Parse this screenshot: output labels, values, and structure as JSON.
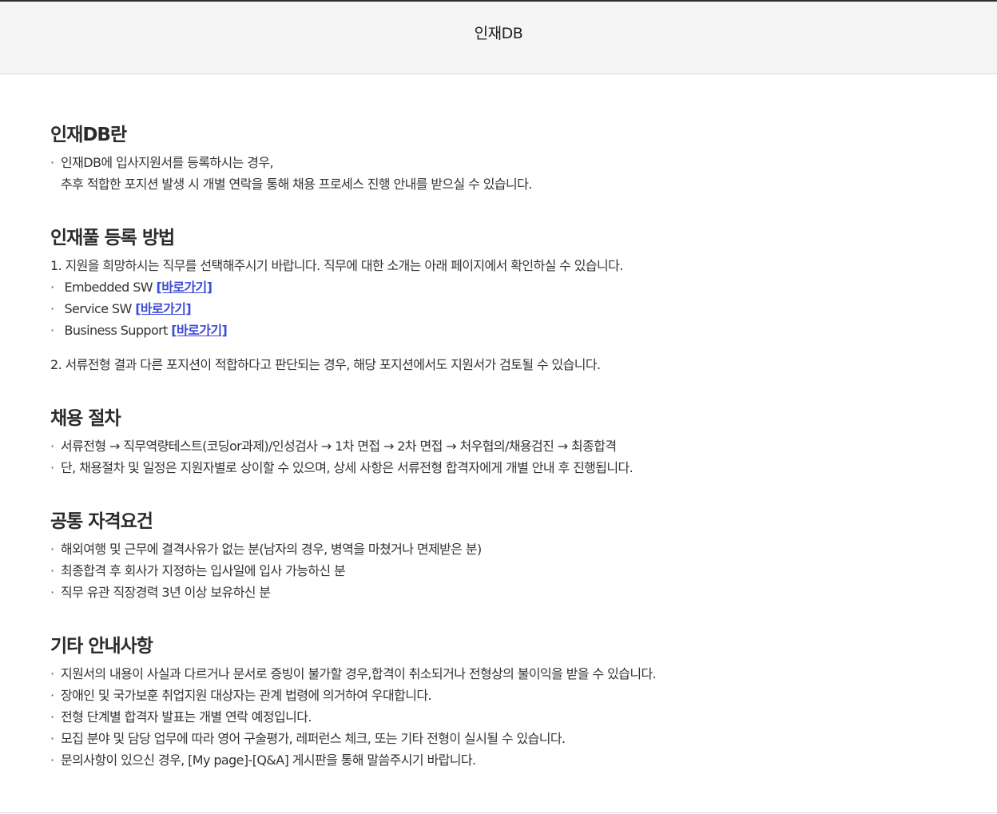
{
  "header": {
    "title": "인재DB"
  },
  "intro": {
    "heading": "인재DB란",
    "line1": "인재DB에 입사지원서를 등록하시는 경우,",
    "line2": "추후 적합한 포지션 발생 시 개별 연락을 통해 채용 프로세스 진행 안내를 받으실 수 있습니다."
  },
  "register": {
    "heading": "인재풀 등록 방법",
    "step1": "1. 지원을 희망하시는 직무를 선택해주시기 바랍니다. 직무에 대한 소개는 아래 페이지에서 확인하실 수 있습니다.",
    "jobs": [
      {
        "name": "Embedded SW",
        "link": "[바로가기]"
      },
      {
        "name": "Service SW",
        "link": "[바로가기]"
      },
      {
        "name": "Business Support",
        "link": "[바로가기]"
      }
    ],
    "step2": "2. 서류전형 결과 다른 포지션이 적합하다고 판단되는 경우, 해당 포지션에서도 지원서가 검토될 수 있습니다."
  },
  "process": {
    "heading": "채용 절차",
    "items": [
      "서류전형 → 직무역량테스트(코딩or과제)/인성검사 → 1차 면접 → 2차 면접 → 처우협의/채용검진 → 최종합격",
      "단, 채용절차 및 일정은 지원자별로 상이할 수 있으며, 상세 사항은 서류전형 합격자에게 개별 안내 후 진행됩니다."
    ]
  },
  "requirements": {
    "heading": "공통 자격요건",
    "items": [
      "해외여행 및 근무에 결격사유가 없는 분(남자의 경우, 병역을 마쳤거나 면제받은 분)",
      "최종합격 후 회사가 지정하는 입사일에 입사 가능하신 분",
      "직무 유관 직장경력 3년 이상 보유하신 분"
    ]
  },
  "notes": {
    "heading": "기타 안내사항",
    "items": [
      "지원서의 내용이 사실과 다르거나 문서로 증빙이 불가할 경우,합격이 취소되거나 전형상의 불이익을 받을 수 있습니다.",
      "장애인 및 국가보훈 취업지원 대상자는 관계 법령에 의거하여 우대합니다.",
      "전형 단계별 합격자 발표는 개별 연락 예정입니다.",
      "모집 분야 및 담당 업무에 따라 영어 구술평가, 레퍼런스 체크, 또는 기타 전형이 실시될 수 있습니다.",
      "문의사항이 있으신 경우, [My page]-[Q&A] 게시판을 통해 말씀주시기 바랍니다."
    ]
  },
  "colors": {
    "link": "#3d4bd6",
    "header_bg": "#f5f5f5",
    "text": "#333333"
  }
}
